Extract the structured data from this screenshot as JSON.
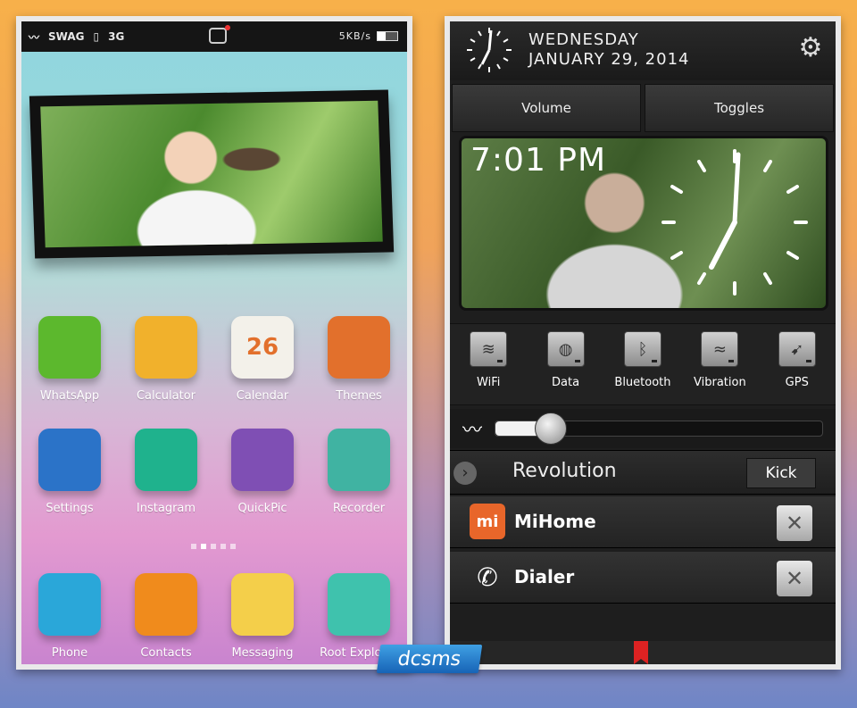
{
  "left_phone": {
    "status_bar": {
      "icons": [
        "mustache-icon",
        "swag-icon",
        "phone-icon"
      ],
      "swag": "SWAG",
      "network": "3G",
      "speed": "5KB/s"
    },
    "dock_dots": 5,
    "apps_row1": [
      {
        "label": "WhatsApp",
        "icon": "whatsapp-icon",
        "color": "#5cb82d"
      },
      {
        "label": "Calculator",
        "icon": "calculator-icon",
        "color": "#f1b12c"
      },
      {
        "label": "Calendar",
        "icon": "calendar-icon",
        "color": "#f3f1ea",
        "date": "26"
      },
      {
        "label": "Themes",
        "icon": "donut-icon",
        "color": "#e2702c"
      }
    ],
    "apps_row2": [
      {
        "label": "Settings",
        "icon": "settings-tools-icon",
        "color": "#2b73c8"
      },
      {
        "label": "Instagram",
        "icon": "monitor-icon",
        "color": "#1fb28d"
      },
      {
        "label": "QuickPic",
        "icon": "gallery-icon",
        "color": "#7f4fb4"
      },
      {
        "label": "Recorder",
        "icon": "turntable-icon",
        "color": "#40b3a2"
      }
    ],
    "apps_dock": [
      {
        "label": "Phone",
        "icon": "phone-handset-icon",
        "color": "#2aa7d9"
      },
      {
        "label": "Contacts",
        "icon": "contacts-icon",
        "color": "#f08b1c"
      },
      {
        "label": "Messaging",
        "icon": "messaging-icon",
        "color": "#f4cf4a"
      },
      {
        "label": "Root Explorer",
        "icon": "briefcase-icon",
        "color": "#3fc2ad"
      }
    ]
  },
  "right_phone": {
    "date_day": "WEDNESDAY",
    "date_full": "JANUARY 29, 2014",
    "tabs": [
      "Volume",
      "Toggles"
    ],
    "widget_time": "7:01 PM",
    "toggles": [
      {
        "label": "WiFi",
        "icon": "wifi-icon"
      },
      {
        "label": "Data",
        "icon": "globe-icon"
      },
      {
        "label": "Bluetooth",
        "icon": "bluetooth-icon"
      },
      {
        "label": "Vibration",
        "icon": "vibration-icon"
      },
      {
        "label": "GPS",
        "icon": "gps-icon"
      }
    ],
    "brightness_level": 0.17,
    "revolution_title": "Revolution",
    "kick_label": "Kick",
    "tasks": [
      {
        "name": "MiHome",
        "icon": "mi-icon",
        "badge": "mi",
        "color": "#e8662a"
      },
      {
        "name": "Dialer",
        "icon": "dialer-icon",
        "color": "#2a2a2a"
      }
    ]
  },
  "watermark": "dcsms"
}
